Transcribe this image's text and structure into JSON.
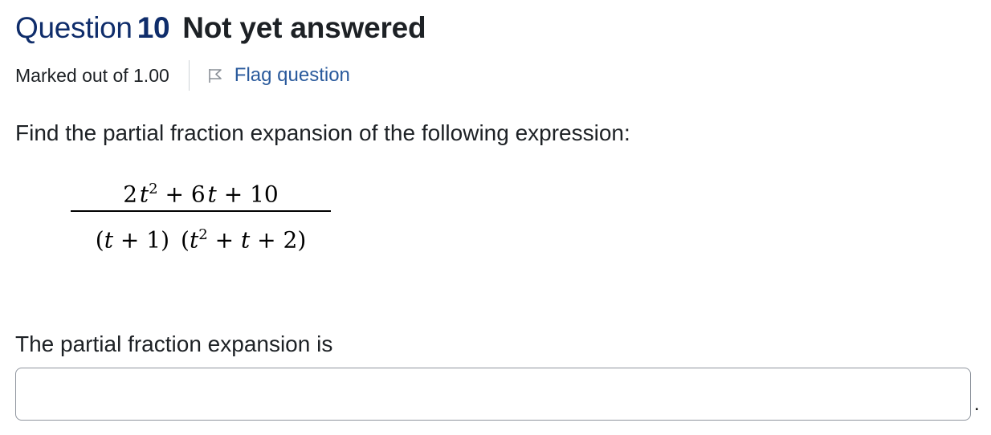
{
  "question": {
    "label": "Question",
    "number": "10",
    "state": "Not yet answered",
    "grade": "Marked out of 1.00",
    "flag_label": "Flag question"
  },
  "prompt": "Find the partial fraction expansion of the following expression:",
  "expression": {
    "numerator": {
      "t2_coef": "2",
      "var": "t",
      "exp": "2",
      "op1": "+",
      "t_coef": "6",
      "op2": "+",
      "const": "10"
    },
    "denominator": {
      "open1": "(",
      "var": "t",
      "op1": "+",
      "c1": "1",
      "close1": ")",
      "open2": "(",
      "exp": "2",
      "op2": "+",
      "op3": "+",
      "c2": "2",
      "close2": ")"
    }
  },
  "answer": {
    "label": "The partial fraction expansion is",
    "value": "",
    "trailing": "."
  },
  "icons": {
    "flag": "flag-icon"
  },
  "colors": {
    "question_number": "#0f2d6b",
    "link": "#2a5a9c",
    "text": "#1d2125",
    "input_border": "#8f959e"
  }
}
